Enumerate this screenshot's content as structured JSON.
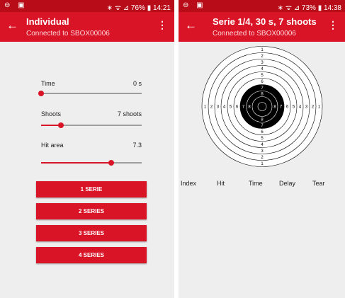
{
  "left_screen": {
    "status": {
      "left_icons": "⊖ ▣",
      "right": "∗ ᯤ ⊿ 76% ▮ 14:21"
    },
    "app_bar": {
      "back_icon": "back-arrow-icon",
      "title": "Individual",
      "subtitle": "Connected to SBOX00006",
      "menu_icon": "overflow-menu-icon"
    },
    "settings": [
      {
        "label": "Time",
        "value": "0 s",
        "fraction": 0.0
      },
      {
        "label": "Shoots",
        "value": "7 shoots",
        "fraction": 0.2
      },
      {
        "label": "Hit area",
        "value": "7.3",
        "fraction": 0.7
      }
    ],
    "buttons": [
      "1 SERIE",
      "2 SERIES",
      "3 SERIES",
      "4 SERIES"
    ]
  },
  "right_screen": {
    "status": {
      "left_icons": "⊖ ▣",
      "right": "∗ ᯤ ⊿ 73% ▮ 14:38"
    },
    "app_bar": {
      "back_icon": "back-arrow-icon",
      "title": "Serie 1/4, 30 s, 7 shoots",
      "subtitle": "Connected to SBOX00006",
      "menu_icon": "overflow-menu-icon"
    },
    "target": {
      "ring_numbers": [
        "1",
        "2",
        "3",
        "4",
        "5",
        "6",
        "7",
        "8"
      ],
      "black_area_color": "#000000",
      "paper_color": "#ffffff"
    },
    "columns": [
      "Index",
      "Hit",
      "Time",
      "Delay",
      "Tear"
    ]
  },
  "colors": {
    "status_bar": "#b80c18",
    "app_bar": "#d91426",
    "accent": "#d91426",
    "background": "#eeeeee"
  }
}
